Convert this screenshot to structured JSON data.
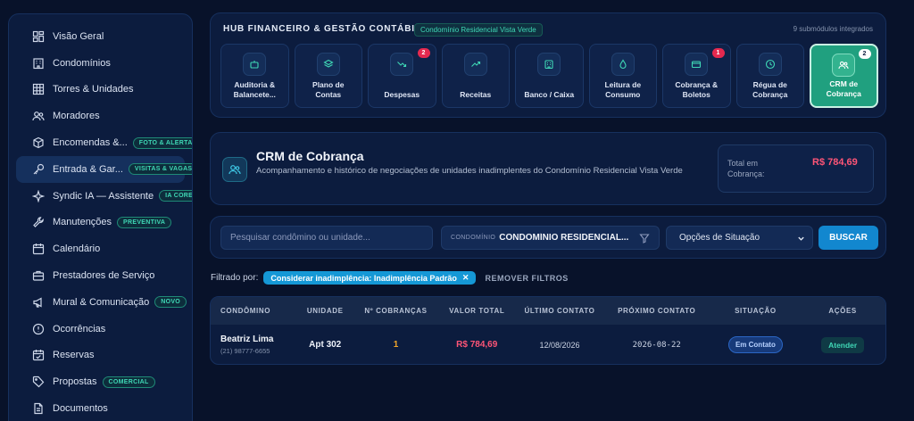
{
  "sidebar": {
    "items": [
      {
        "label": "Visão Geral",
        "icon": "dashboard-icon"
      },
      {
        "label": "Condomínios",
        "icon": "building-icon"
      },
      {
        "label": "Torres & Unidades",
        "icon": "grid-icon"
      },
      {
        "label": "Moradores",
        "icon": "users-icon"
      },
      {
        "label": "Encomendas &...",
        "icon": "package-icon",
        "badge": "FOTO & ALERTA"
      },
      {
        "label": "Entrada & Gar...",
        "icon": "key-icon",
        "badge": "VISITAS & VAGAS"
      },
      {
        "label": "Syndic IA — Assistente",
        "icon": "sparkle-icon",
        "badge": "IA CORE"
      },
      {
        "label": "Manutenções",
        "icon": "wrench-icon",
        "badge": "PREVENTIVA"
      },
      {
        "label": "Calendário",
        "icon": "calendar-icon"
      },
      {
        "label": "Prestadores de Serviço",
        "icon": "briefcase-icon"
      },
      {
        "label": "Mural & Comunicação",
        "icon": "megaphone-icon",
        "badge": "NOVO"
      },
      {
        "label": "Ocorrências",
        "icon": "alert-circle-icon"
      },
      {
        "label": "Reservas",
        "icon": "calendar-check-icon"
      },
      {
        "label": "Propostas",
        "icon": "tag-icon",
        "badge": "COMERCIAL"
      },
      {
        "label": "Documentos",
        "icon": "document-icon"
      }
    ]
  },
  "hub": {
    "title": "HUB FINANCEIRO & GESTÃO CONTÁBIL",
    "condo_badge": "Condomínio Residencial Vista Verde",
    "submodules_count": "9 submódulos integrados",
    "modules": [
      {
        "label": "Auditoria & Balancete...",
        "icon": "robot-icon"
      },
      {
        "label": "Plano de Contas",
        "icon": "layers-icon"
      },
      {
        "label": "Despesas",
        "icon": "trend-down-icon",
        "badge": "2"
      },
      {
        "label": "Receitas",
        "icon": "trend-up-icon"
      },
      {
        "label": "Banco / Caixa",
        "icon": "bank-icon"
      },
      {
        "label": "Leitura de Consumo",
        "icon": "droplet-icon"
      },
      {
        "label": "Cobrança & Boletos",
        "icon": "card-icon",
        "badge": "1"
      },
      {
        "label": "Régua de Cobrança",
        "icon": "clock-icon"
      },
      {
        "label": "CRM de Cobrança",
        "icon": "users-icon",
        "badge": "2",
        "active": true
      }
    ]
  },
  "crm": {
    "title": "CRM de Cobrança",
    "description": "Acompanhamento e histórico de negociações de unidades inadimplentes do Condomínio Residencial Vista Verde",
    "total_label": "Total em Cobrança:",
    "total_value": "R$ 784,69"
  },
  "filters": {
    "search_placeholder": "Pesquisar condômino ou unidade...",
    "condo_label": "CONDOMÍNIO",
    "condo_value": "CONDOMÍNIO RESIDENCIAL...",
    "status_value": "Opções de Situação",
    "search_button": "BUSCAR"
  },
  "active_filters": {
    "label": "Filtrado por:",
    "chip": "Considerar inadimplência: Inadimplência Padrão",
    "remove": "REMOVER FILTROS"
  },
  "table": {
    "headers": [
      "CONDÔMINO",
      "UNIDADE",
      "Nº COBRANÇAS",
      "VALOR TOTAL",
      "ÚLTIMO CONTATO",
      "PRÓXIMO CONTATO",
      "SITUAÇÃO",
      "AÇÕES"
    ],
    "rows": [
      {
        "name": "Beatriz Lima",
        "phone": "(21) 98777-6655",
        "unit": "Apt 302",
        "count": "1",
        "value": "R$ 784,69",
        "last_contact": "12/08/2026",
        "next_contact": "2026-08-22",
        "status": "Em Contato",
        "action": "Atender"
      }
    ]
  },
  "colors": {
    "accent": "#20a07f",
    "danger": "#ff5577",
    "primary_button": "#1287cf",
    "warning": "#f2a629"
  }
}
